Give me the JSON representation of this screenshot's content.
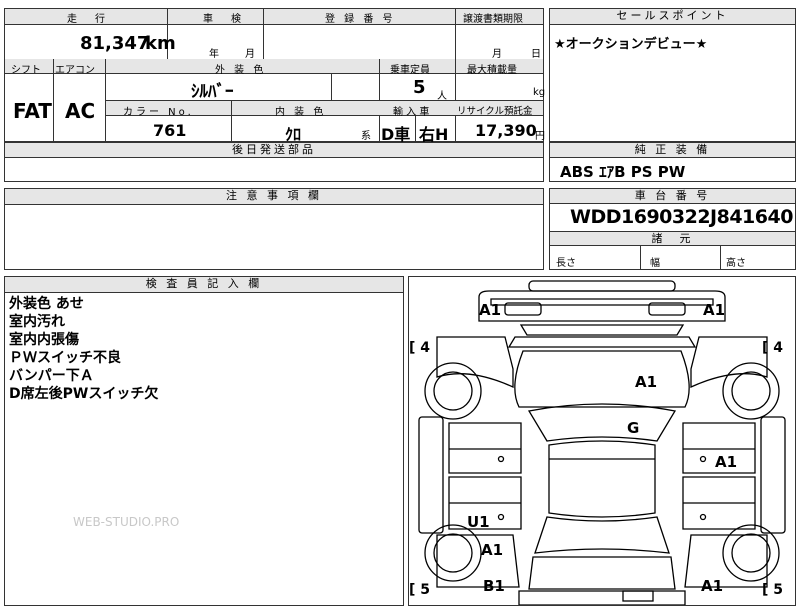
{
  "left_top": {
    "headers": {
      "mileage": "走　行",
      "inspection": "車　検",
      "registration": "登 録 番 号",
      "transfer_deadline": "譲渡書類期限",
      "shift": "シフト",
      "aircon": "エアコン",
      "exterior_color": "外 装 色",
      "capacity": "乗車定員",
      "max_load": "最大積載量",
      "color_no": "カラー No.",
      "interior_color": "内 装 色",
      "import": "輸 入 車",
      "recycle": "リサイクル預託金",
      "later_parts": "後日発送部品"
    },
    "mileage_value": "81,347",
    "mileage_unit": "km",
    "year_unit": "年",
    "month_unit": "月",
    "deadline_month": "月",
    "deadline_day": "日",
    "shift_value": "FAT",
    "aircon_value": "AC",
    "exterior_color_value": "ｼﾙﾊﾞｰ",
    "capacity_value": "5",
    "capacity_unit": "人",
    "load_unit": "kg",
    "color_no_value": "761",
    "interior_color_value": "ｸﾛ",
    "interior_suffix": "系",
    "import_value_1": "D車",
    "import_value_2": "右H",
    "recycle_value": "17,390",
    "recycle_unit": "円"
  },
  "right_top": {
    "sales_point_header": "セールスポイント",
    "sales_point_text": "★オークションデビュー★",
    "equipment_header": "純 正 装 備",
    "equipment_value": "ABS ｴｱB PS PW",
    "chassis_header": "車 台 番 号",
    "chassis_value": "WDD1690322J841640",
    "dimensions_header": "諸　元",
    "length_label": "長さ",
    "width_label": "幅",
    "height_label": "高さ"
  },
  "notes": {
    "header": "注 意 事 項 欄"
  },
  "inspector": {
    "header": "検 査 員 記 入 欄",
    "remarks": [
      "外装色 あせ",
      "室内汚れ",
      "室内内張傷",
      "ＰＷスイッチ不良",
      "バンパー下Ａ",
      "D席左後PWスイッチ欠"
    ],
    "watermark": "WEB-STUDIO.PRO"
  },
  "diagram": {
    "tire_fl": "[ 4",
    "tire_fr": "[ 4",
    "tire_rl": "[ 5",
    "tire_rr": "[ 5",
    "marks": {
      "front_bumper_left": "A1",
      "front_bumper_right": "A1",
      "hood": "A1",
      "windshield": "G",
      "right_door": "A1",
      "left_rear_door": "U1",
      "left_rear_fender": "A1",
      "rear_left": "B1",
      "rear_right": "A1"
    }
  }
}
